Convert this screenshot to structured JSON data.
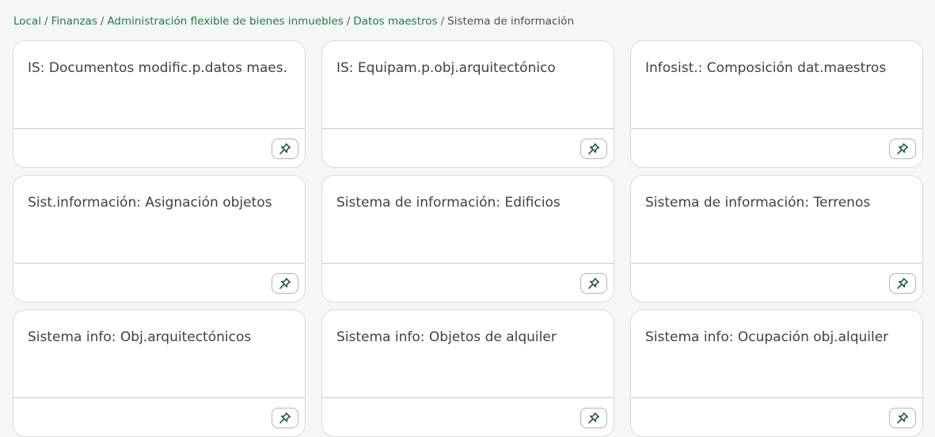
{
  "breadcrumb": {
    "items": [
      {
        "label": "Local",
        "link": true
      },
      {
        "label": "Finanzas",
        "link": true
      },
      {
        "label": "Administración flexible de bienes inmuebles",
        "link": true
      },
      {
        "label": "Datos maestros",
        "link": true
      },
      {
        "label": "Sistema de información",
        "link": false
      }
    ],
    "separator": "/"
  },
  "tiles": [
    {
      "title": "IS: Documentos modific.p.datos maes.",
      "pin_icon": "pin-icon"
    },
    {
      "title": "IS: Equipam.p.obj.arquitectónico",
      "pin_icon": "pin-icon"
    },
    {
      "title": "Infosist.: Composición dat.maestros",
      "pin_icon": "pin-icon"
    },
    {
      "title": "Sist.información: Asignación objetos",
      "pin_icon": "pin-icon"
    },
    {
      "title": "Sistema de información: Edificios",
      "pin_icon": "pin-icon"
    },
    {
      "title": "Sistema de información: Terrenos",
      "pin_icon": "pin-icon"
    },
    {
      "title": "Sistema info: Obj.arquitectónicos",
      "pin_icon": "pin-icon"
    },
    {
      "title": "Sistema info: Objetos de alquiler",
      "pin_icon": "pin-icon"
    },
    {
      "title": "Sistema info: Ocupación obj.alquiler",
      "pin_icon": "pin-icon"
    }
  ],
  "colors": {
    "link": "#1a7f3c",
    "pin_icon": "#1f5f36",
    "background": "#f5f6f7",
    "tile_border": "#d8dbdf"
  }
}
